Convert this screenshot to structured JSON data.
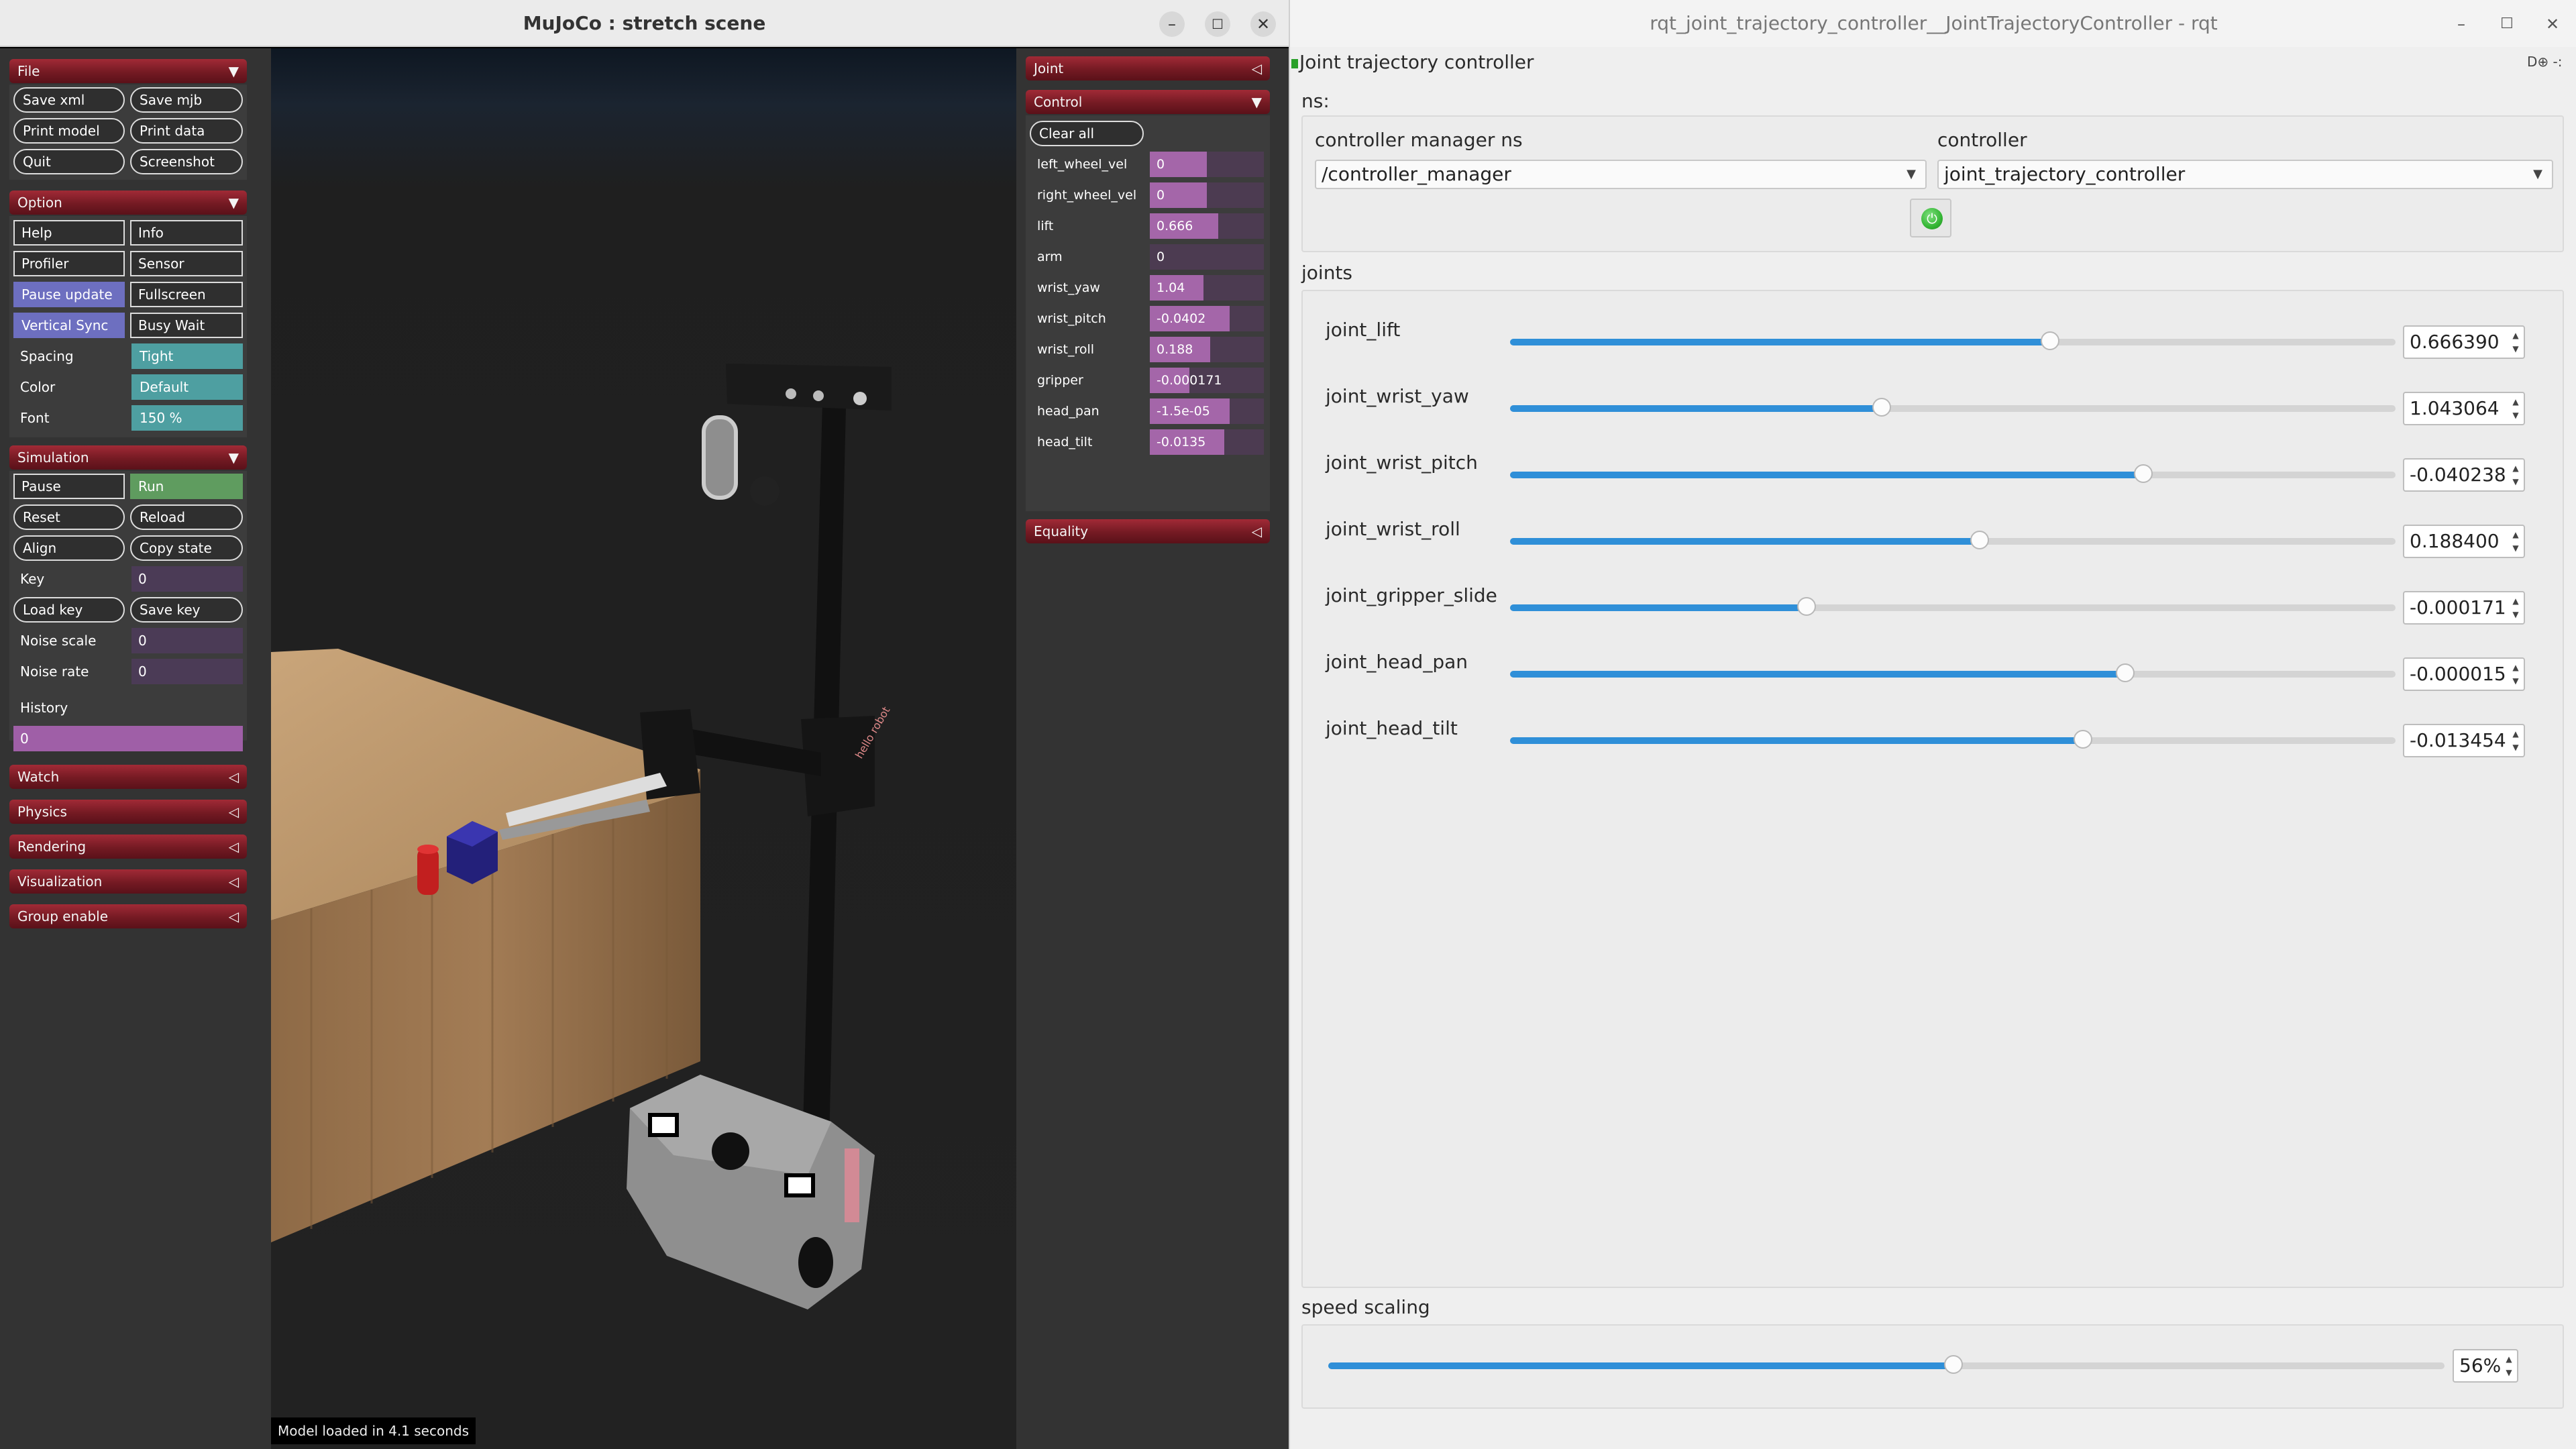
{
  "mujoco": {
    "title": "MuJoCo : stretch scene",
    "status": "Model loaded in 4.1 seconds",
    "left_panel": {
      "file": {
        "header": "File",
        "buttons": [
          "Save xml",
          "Save mjb",
          "Print model",
          "Print data",
          "Quit",
          "Screenshot"
        ]
      },
      "option": {
        "header": "Option",
        "checks": [
          {
            "label": "Help",
            "on": false
          },
          {
            "label": "Info",
            "on": false
          },
          {
            "label": "Profiler",
            "on": false
          },
          {
            "label": "Sensor",
            "on": false
          },
          {
            "label": "Pause update",
            "on": true
          },
          {
            "label": "Fullscreen",
            "on": false
          },
          {
            "label": "Vertical Sync",
            "on": true
          },
          {
            "label": "Busy Wait",
            "on": false
          }
        ],
        "spacing_label": "Spacing",
        "spacing_value": "Tight",
        "color_label": "Color",
        "color_value": "Default",
        "font_label": "Font",
        "font_value": "150 %"
      },
      "simulation": {
        "header": "Simulation",
        "pause_label": "Pause",
        "run_label": "Run",
        "buttons": [
          "Reset",
          "Reload",
          "Align",
          "Copy state"
        ],
        "key_label": "Key",
        "key_value": "0",
        "load_key": "Load key",
        "save_key": "Save key",
        "noise_scale_label": "Noise scale",
        "noise_scale_value": "0",
        "noise_rate_label": "Noise rate",
        "noise_rate_value": "0",
        "history_label": "History",
        "history_value": "0"
      },
      "collapsed_sections": [
        "Watch",
        "Physics",
        "Rendering",
        "Visualization",
        "Group enable"
      ]
    },
    "right_panel": {
      "joint_header": "Joint",
      "control_header": "Control",
      "clear_all": "Clear all",
      "controls": [
        {
          "name": "left_wheel_vel",
          "value": "0",
          "fill": 0.5
        },
        {
          "name": "right_wheel_vel",
          "value": "0",
          "fill": 0.5
        },
        {
          "name": "lift",
          "value": "0.666",
          "fill": 0.6
        },
        {
          "name": "arm",
          "value": "0",
          "fill": 0.0
        },
        {
          "name": "wrist_yaw",
          "value": "1.04",
          "fill": 0.47
        },
        {
          "name": "wrist_pitch",
          "value": "-0.0402",
          "fill": 0.7
        },
        {
          "name": "wrist_roll",
          "value": "0.188",
          "fill": 0.53
        },
        {
          "name": "gripper",
          "value": "-0.000171",
          "fill": 0.35
        },
        {
          "name": "head_pan",
          "value": "-1.5e-05",
          "fill": 0.7
        },
        {
          "name": "head_tilt",
          "value": "-0.0135",
          "fill": 0.65
        }
      ],
      "equality_header": "Equality"
    },
    "scene_labels": {
      "robot_brand": "hello robot"
    }
  },
  "rqt": {
    "title": "rqt_joint_trajectory_controller__JointTrajectoryController - rqt",
    "plugin_title": "Joint trajectory controller",
    "ns_label": "ns:",
    "cm_ns_label": "controller manager ns",
    "cm_ns_value": "/controller_manager",
    "controller_label": "controller",
    "controller_value": "joint_trajectory_controller",
    "joints_label": "joints",
    "joints": [
      {
        "name": "joint_lift",
        "value": "0.666390",
        "fraction": 0.61
      },
      {
        "name": "joint_wrist_yaw",
        "value": "1.043064",
        "fraction": 0.42
      },
      {
        "name": "joint_wrist_pitch",
        "value": "-0.040238",
        "fraction": 0.715
      },
      {
        "name": "joint_wrist_roll",
        "value": "0.188400",
        "fraction": 0.53
      },
      {
        "name": "joint_gripper_slide",
        "value": "-0.000171",
        "fraction": 0.335
      },
      {
        "name": "joint_head_pan",
        "value": "-0.000015",
        "fraction": 0.695
      },
      {
        "name": "joint_head_tilt",
        "value": "-0.013454",
        "fraction": 0.647
      }
    ],
    "speed_scaling_label": "speed scaling",
    "speed_scaling_value": "56%",
    "speed_scaling_fraction": 0.56
  }
}
